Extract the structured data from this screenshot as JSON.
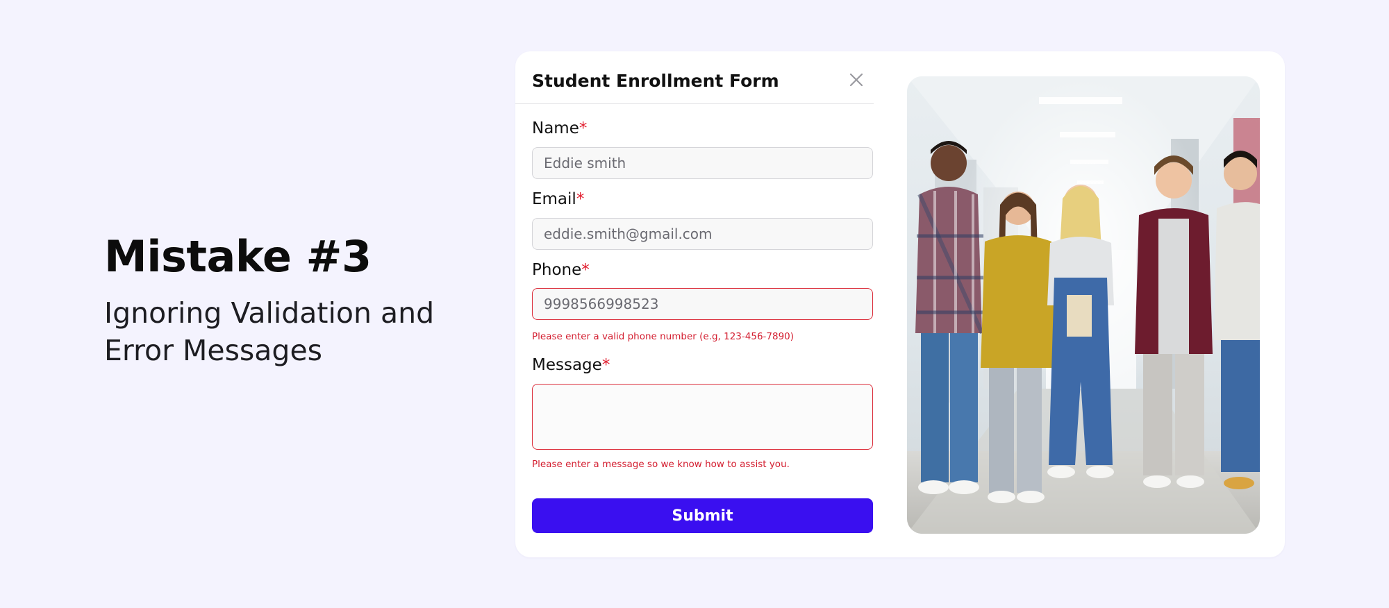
{
  "hero": {
    "title": "Mistake #3",
    "subtitle": "Ignoring Validation and Error Messages"
  },
  "form": {
    "title": "Student Enrollment Form",
    "close_icon": "close-icon",
    "required_marker": "*",
    "fields": {
      "name": {
        "label": "Name",
        "value": "Eddie smith"
      },
      "email": {
        "label": "Email",
        "value": "eddie.smith@gmail.com"
      },
      "phone": {
        "label": "Phone",
        "value": "9998566998523",
        "error": "Please enter a valid phone number (e.g, 123-456-7890)"
      },
      "message": {
        "label": "Message",
        "value": "",
        "error": "Please enter a message so we know how to assist you."
      }
    },
    "submit_label": "Submit"
  },
  "colors": {
    "background": "#f4f3fe",
    "accent": "#3a0ff0",
    "error": "#dc2f3c",
    "card": "#ffffff"
  }
}
